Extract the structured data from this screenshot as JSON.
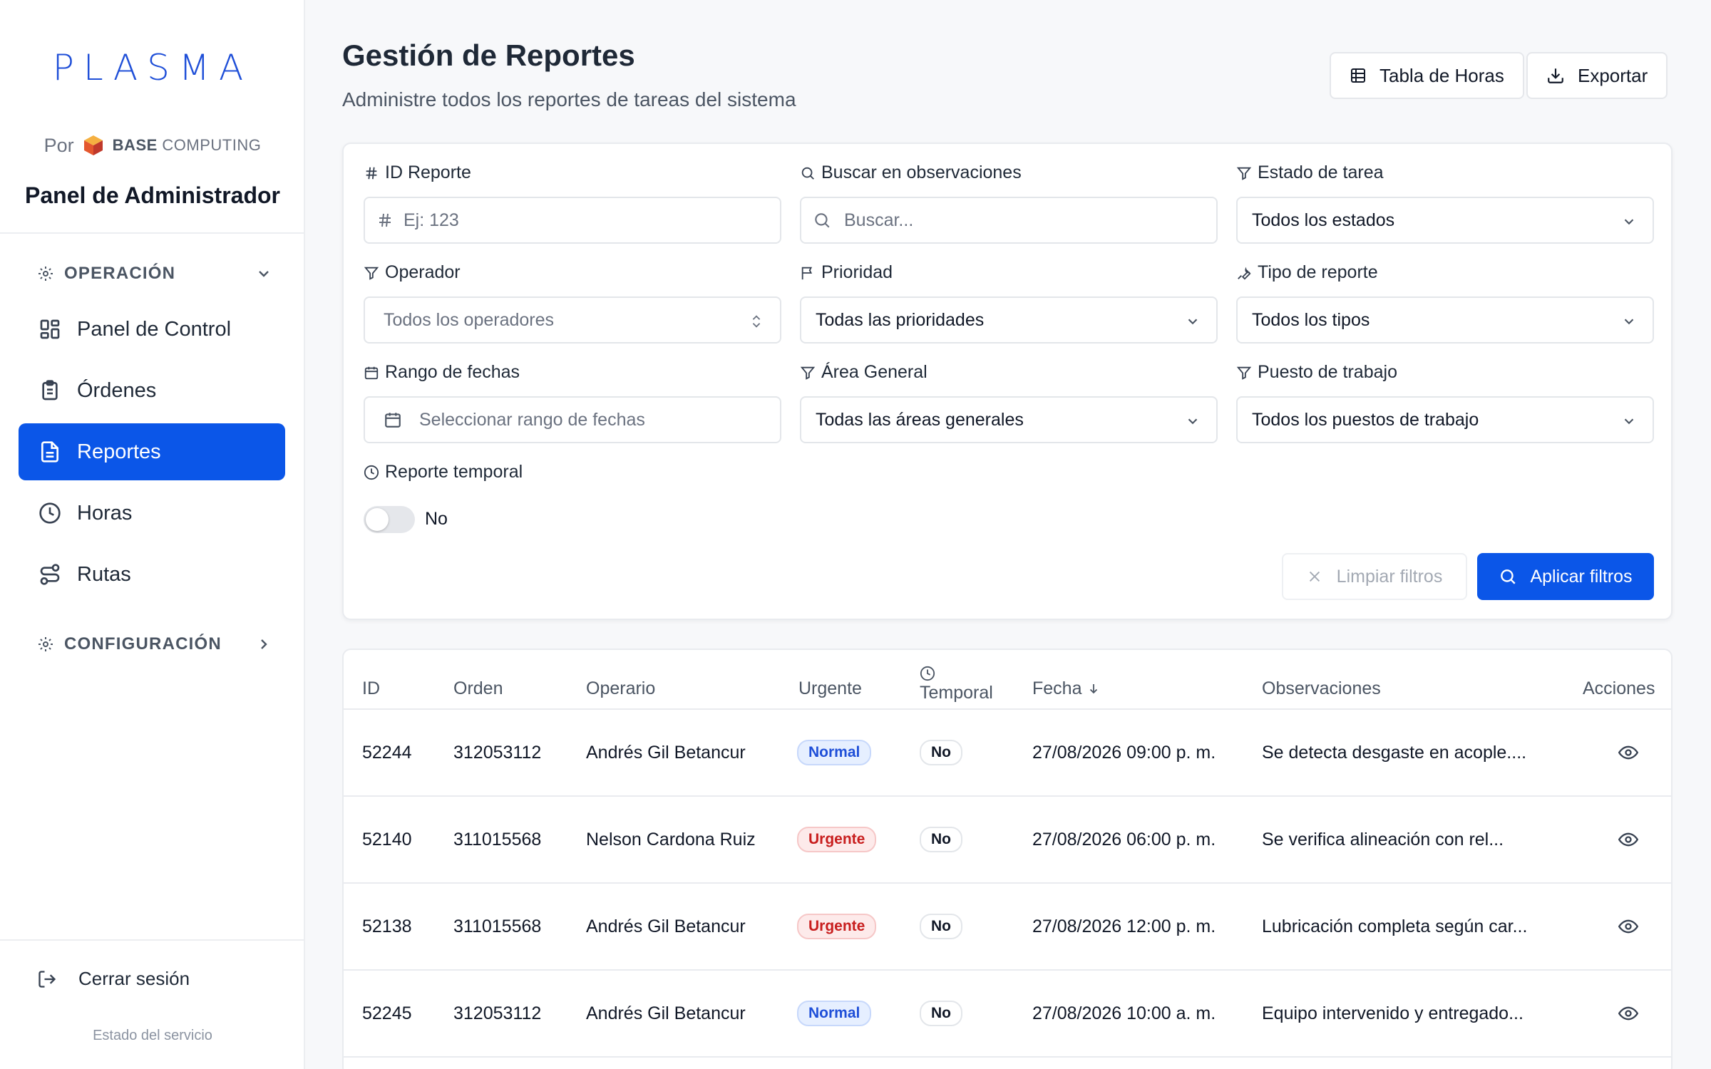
{
  "sidebar": {
    "logo": "PLASMA",
    "by_prefix": "Por",
    "brand_bold": "BASE",
    "brand_rest": " COMPUTING",
    "title": "Panel de Administrador",
    "section_operacion": "OPERACIÓN",
    "items": [
      {
        "label": "Panel de Control",
        "icon": "dashboard-icon"
      },
      {
        "label": "Órdenes",
        "icon": "clipboard-icon"
      },
      {
        "label": "Reportes",
        "icon": "report-icon",
        "active": true
      },
      {
        "label": "Horas",
        "icon": "clock-icon"
      },
      {
        "label": "Rutas",
        "icon": "route-icon"
      }
    ],
    "section_config": "CONFIGURACIÓN",
    "logout": "Cerrar sesión",
    "service_status": "Estado del servicio"
  },
  "header": {
    "title": "Gestión de Reportes",
    "subtitle": "Administre todos los reportes de tareas del sistema",
    "btn_hours": "Tabla de Horas",
    "btn_export": "Exportar"
  },
  "filters": {
    "id_label": "ID Reporte",
    "id_placeholder": "Ej: 123",
    "search_label": "Buscar en observaciones",
    "search_placeholder": "Buscar...",
    "estado_label": "Estado de tarea",
    "estado_value": "Todos los estados",
    "operador_label": "Operador",
    "operador_placeholder": "Todos los operadores",
    "prioridad_label": "Prioridad",
    "prioridad_value": "Todas las prioridades",
    "tipo_label": "Tipo de reporte",
    "tipo_value": "Todos los tipos",
    "fechas_label": "Rango de fechas",
    "fechas_placeholder": "Seleccionar rango de fechas",
    "area_label": "Área General",
    "area_value": "Todas las áreas generales",
    "puesto_label": "Puesto de trabajo",
    "puesto_value": "Todos los puestos de trabajo",
    "temporal_label": "Reporte temporal",
    "temporal_value": "No",
    "clear_label": "Limpiar filtros",
    "apply_label": "Aplicar filtros"
  },
  "table": {
    "columns": {
      "id": "ID",
      "orden": "Orden",
      "operario": "Operario",
      "urgente": "Urgente",
      "temporal": "Temporal",
      "fecha": "Fecha",
      "observaciones": "Observaciones",
      "acciones": "Acciones"
    },
    "rows": [
      {
        "id": "52244",
        "orden": "312053112",
        "operario": "Andrés Gil Betancur",
        "urgente": "Normal",
        "temporal": "No",
        "fecha": "27/08/2026 09:00 p. m.",
        "obs": "Se detecta desgaste en acople...."
      },
      {
        "id": "52140",
        "orden": "311015568",
        "operario": "Nelson Cardona Ruiz",
        "urgente": "Urgente",
        "temporal": "No",
        "fecha": "27/08/2026 06:00 p. m.",
        "obs": "Se verifica alineación con rel..."
      },
      {
        "id": "52138",
        "orden": "311015568",
        "operario": "Andrés Gil Betancur",
        "urgente": "Urgente",
        "temporal": "No",
        "fecha": "27/08/2026 12:00 p. m.",
        "obs": "Lubricación completa según car..."
      },
      {
        "id": "52245",
        "orden": "312053112",
        "operario": "Andrés Gil Betancur",
        "urgente": "Normal",
        "temporal": "No",
        "fecha": "27/08/2026 10:00 a. m.",
        "obs": "Equipo intervenido y entregado..."
      }
    ]
  },
  "colors": {
    "primary": "#0b56e8",
    "normal_badge": "#1f4fd8",
    "urgent_badge": "#c81e1e"
  }
}
